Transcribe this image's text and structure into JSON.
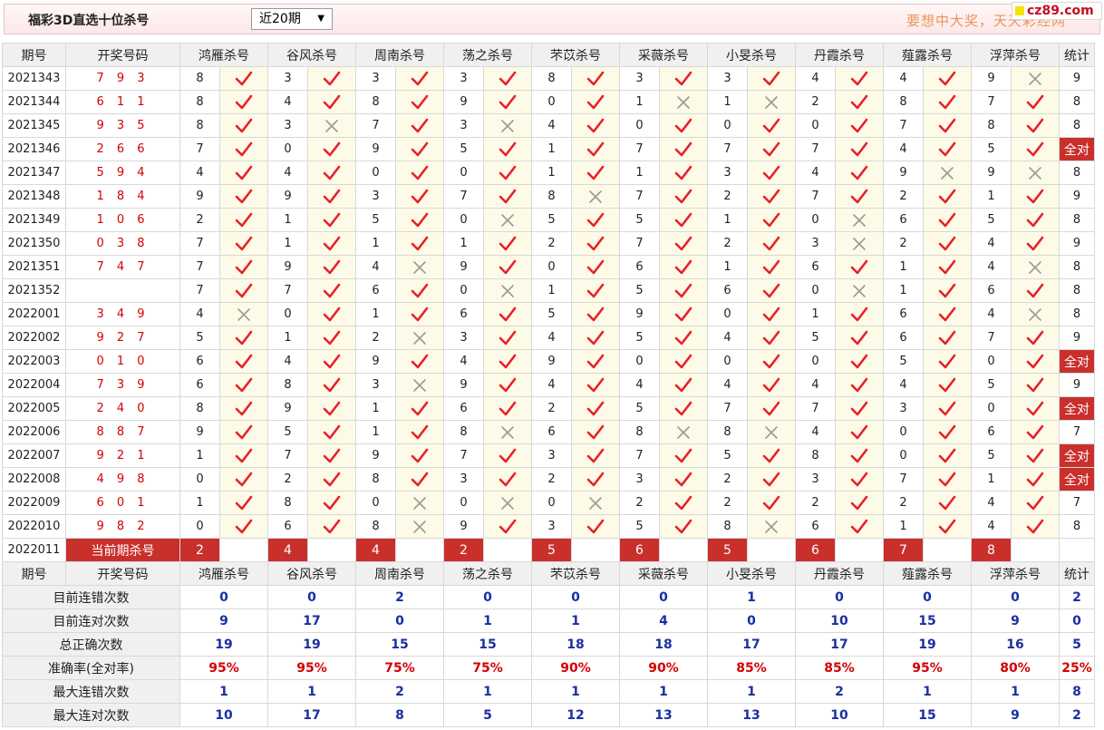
{
  "header": {
    "title": "福彩3D直选十位杀号",
    "period_select": "近20期",
    "promo": "要想中大奖，天天彩经网",
    "site_logo": "cz89.com"
  },
  "columns": {
    "issue": "期号",
    "winning": "开奖号码",
    "experts": [
      "鸿雁杀号",
      "谷风杀号",
      "周南杀号",
      "荡之杀号",
      "芣苡杀号",
      "采薇杀号",
      "小旻杀号",
      "丹霞杀号",
      "薤露杀号",
      "浮萍杀号"
    ],
    "stat": "统计"
  },
  "rows": [
    {
      "issue": "2021343",
      "win": "7 9 3",
      "kills": [
        "8",
        "3",
        "3",
        "3",
        "8",
        "3",
        "3",
        "4",
        "4",
        "9"
      ],
      "ok": [
        1,
        1,
        1,
        1,
        1,
        1,
        1,
        1,
        1,
        0
      ],
      "stat": "9"
    },
    {
      "issue": "2021344",
      "win": "6 1 1",
      "kills": [
        "8",
        "4",
        "8",
        "9",
        "0",
        "1",
        "1",
        "2",
        "8",
        "7"
      ],
      "ok": [
        1,
        1,
        1,
        1,
        1,
        0,
        0,
        1,
        1,
        1
      ],
      "stat": "8"
    },
    {
      "issue": "2021345",
      "win": "9 3 5",
      "kills": [
        "8",
        "3",
        "7",
        "3",
        "4",
        "0",
        "0",
        "0",
        "7",
        "8"
      ],
      "ok": [
        1,
        0,
        1,
        0,
        1,
        1,
        1,
        1,
        1,
        1
      ],
      "stat": "8"
    },
    {
      "issue": "2021346",
      "win": "2 6 6",
      "kills": [
        "7",
        "0",
        "9",
        "5",
        "1",
        "7",
        "7",
        "7",
        "4",
        "5"
      ],
      "ok": [
        1,
        1,
        1,
        1,
        1,
        1,
        1,
        1,
        1,
        1
      ],
      "stat": "全对"
    },
    {
      "issue": "2021347",
      "win": "5 9 4",
      "kills": [
        "4",
        "4",
        "0",
        "0",
        "1",
        "1",
        "3",
        "4",
        "9",
        "9"
      ],
      "ok": [
        1,
        1,
        1,
        1,
        1,
        1,
        1,
        1,
        0,
        0
      ],
      "stat": "8"
    },
    {
      "issue": "2021348",
      "win": "1 8 4",
      "kills": [
        "9",
        "9",
        "3",
        "7",
        "8",
        "7",
        "2",
        "7",
        "2",
        "1"
      ],
      "ok": [
        1,
        1,
        1,
        1,
        0,
        1,
        1,
        1,
        1,
        1
      ],
      "stat": "9"
    },
    {
      "issue": "2021349",
      "win": "1 0 6",
      "kills": [
        "2",
        "1",
        "5",
        "0",
        "5",
        "5",
        "1",
        "0",
        "6",
        "5"
      ],
      "ok": [
        1,
        1,
        1,
        0,
        1,
        1,
        1,
        0,
        1,
        1
      ],
      "stat": "8"
    },
    {
      "issue": "2021350",
      "win": "0 3 8",
      "kills": [
        "7",
        "1",
        "1",
        "1",
        "2",
        "7",
        "2",
        "3",
        "2",
        "4"
      ],
      "ok": [
        1,
        1,
        1,
        1,
        1,
        1,
        1,
        0,
        1,
        1
      ],
      "stat": "9"
    },
    {
      "issue": "2021351",
      "win": "7 4 7",
      "kills": [
        "7",
        "9",
        "4",
        "9",
        "0",
        "6",
        "1",
        "6",
        "1",
        "4"
      ],
      "ok": [
        1,
        1,
        0,
        1,
        1,
        1,
        1,
        1,
        1,
        0
      ],
      "stat": "8"
    },
    {
      "issue": "2021352",
      "win": "",
      "kills": [
        "7",
        "7",
        "6",
        "0",
        "1",
        "5",
        "6",
        "0",
        "1",
        "6"
      ],
      "ok": [
        1,
        1,
        1,
        0,
        1,
        1,
        1,
        0,
        1,
        1
      ],
      "stat": "8"
    },
    {
      "issue": "2022001",
      "win": "3 4 9",
      "kills": [
        "4",
        "0",
        "1",
        "6",
        "5",
        "9",
        "0",
        "1",
        "6",
        "4"
      ],
      "ok": [
        0,
        1,
        1,
        1,
        1,
        1,
        1,
        1,
        1,
        0
      ],
      "stat": "8"
    },
    {
      "issue": "2022002",
      "win": "9 2 7",
      "kills": [
        "5",
        "1",
        "2",
        "3",
        "4",
        "5",
        "4",
        "5",
        "6",
        "7"
      ],
      "ok": [
        1,
        1,
        0,
        1,
        1,
        1,
        1,
        1,
        1,
        1
      ],
      "stat": "9"
    },
    {
      "issue": "2022003",
      "win": "0 1 0",
      "kills": [
        "6",
        "4",
        "9",
        "4",
        "9",
        "0",
        "0",
        "0",
        "5",
        "0"
      ],
      "ok": [
        1,
        1,
        1,
        1,
        1,
        1,
        1,
        1,
        1,
        1
      ],
      "stat": "全对"
    },
    {
      "issue": "2022004",
      "win": "7 3 9",
      "kills": [
        "6",
        "8",
        "3",
        "9",
        "4",
        "4",
        "4",
        "4",
        "4",
        "5"
      ],
      "ok": [
        1,
        1,
        0,
        1,
        1,
        1,
        1,
        1,
        1,
        1
      ],
      "stat": "9"
    },
    {
      "issue": "2022005",
      "win": "2 4 0",
      "kills": [
        "8",
        "9",
        "1",
        "6",
        "2",
        "5",
        "7",
        "7",
        "3",
        "0"
      ],
      "ok": [
        1,
        1,
        1,
        1,
        1,
        1,
        1,
        1,
        1,
        1
      ],
      "stat": "全对"
    },
    {
      "issue": "2022006",
      "win": "8 8 7",
      "kills": [
        "9",
        "5",
        "1",
        "8",
        "6",
        "8",
        "8",
        "4",
        "0",
        "6"
      ],
      "ok": [
        1,
        1,
        1,
        0,
        1,
        0,
        0,
        1,
        1,
        1
      ],
      "stat": "7"
    },
    {
      "issue": "2022007",
      "win": "9 2 1",
      "kills": [
        "1",
        "7",
        "9",
        "7",
        "3",
        "7",
        "5",
        "8",
        "0",
        "5"
      ],
      "ok": [
        1,
        1,
        1,
        1,
        1,
        1,
        1,
        1,
        1,
        1
      ],
      "stat": "全对"
    },
    {
      "issue": "2022008",
      "win": "4 9 8",
      "kills": [
        "0",
        "2",
        "8",
        "3",
        "2",
        "3",
        "2",
        "3",
        "7",
        "1"
      ],
      "ok": [
        1,
        1,
        1,
        1,
        1,
        1,
        1,
        1,
        1,
        1
      ],
      "stat": "全对"
    },
    {
      "issue": "2022009",
      "win": "6 0 1",
      "kills": [
        "1",
        "8",
        "0",
        "0",
        "0",
        "2",
        "2",
        "2",
        "2",
        "4"
      ],
      "ok": [
        1,
        1,
        0,
        0,
        0,
        1,
        1,
        1,
        1,
        1
      ],
      "stat": "7"
    },
    {
      "issue": "2022010",
      "win": "9 8 2",
      "kills": [
        "0",
        "6",
        "8",
        "9",
        "3",
        "5",
        "8",
        "6",
        "1",
        "4"
      ],
      "ok": [
        1,
        1,
        0,
        1,
        1,
        1,
        0,
        1,
        1,
        1
      ],
      "stat": "8"
    }
  ],
  "current": {
    "issue": "2022011",
    "label": "当前期杀号",
    "kills": [
      "2",
      "4",
      "4",
      "2",
      "5",
      "6",
      "5",
      "6",
      "7",
      "8"
    ]
  },
  "summary": [
    {
      "label": "目前连错次数",
      "values": [
        "0",
        "0",
        "2",
        "0",
        "0",
        "0",
        "1",
        "0",
        "0",
        "0"
      ],
      "stat": "2",
      "pct": false
    },
    {
      "label": "目前连对次数",
      "values": [
        "9",
        "17",
        "0",
        "1",
        "1",
        "4",
        "0",
        "10",
        "15",
        "9"
      ],
      "stat": "0",
      "pct": false
    },
    {
      "label": "总正确次数",
      "values": [
        "19",
        "19",
        "15",
        "15",
        "18",
        "18",
        "17",
        "17",
        "19",
        "16"
      ],
      "stat": "5",
      "pct": false
    },
    {
      "label": "准确率(全对率)",
      "values": [
        "95%",
        "95%",
        "75%",
        "75%",
        "90%",
        "90%",
        "85%",
        "85%",
        "95%",
        "80%"
      ],
      "stat": "25%",
      "pct": true
    },
    {
      "label": "最大连错次数",
      "values": [
        "1",
        "1",
        "2",
        "1",
        "1",
        "1",
        "1",
        "2",
        "1",
        "1"
      ],
      "stat": "8",
      "pct": false
    },
    {
      "label": "最大连对次数",
      "values": [
        "10",
        "17",
        "8",
        "5",
        "12",
        "13",
        "13",
        "10",
        "15",
        "9"
      ],
      "stat": "2",
      "pct": false
    }
  ],
  "colors": {
    "accent_red": "#c9302c",
    "check_red": "#e8202a",
    "cross_gray": "#9a9a9a",
    "mark_bg": "#fdfbe7",
    "summary_blue": "#1b2fa0"
  },
  "icons": {
    "ok": "check-icon",
    "miss": "cross-icon"
  }
}
